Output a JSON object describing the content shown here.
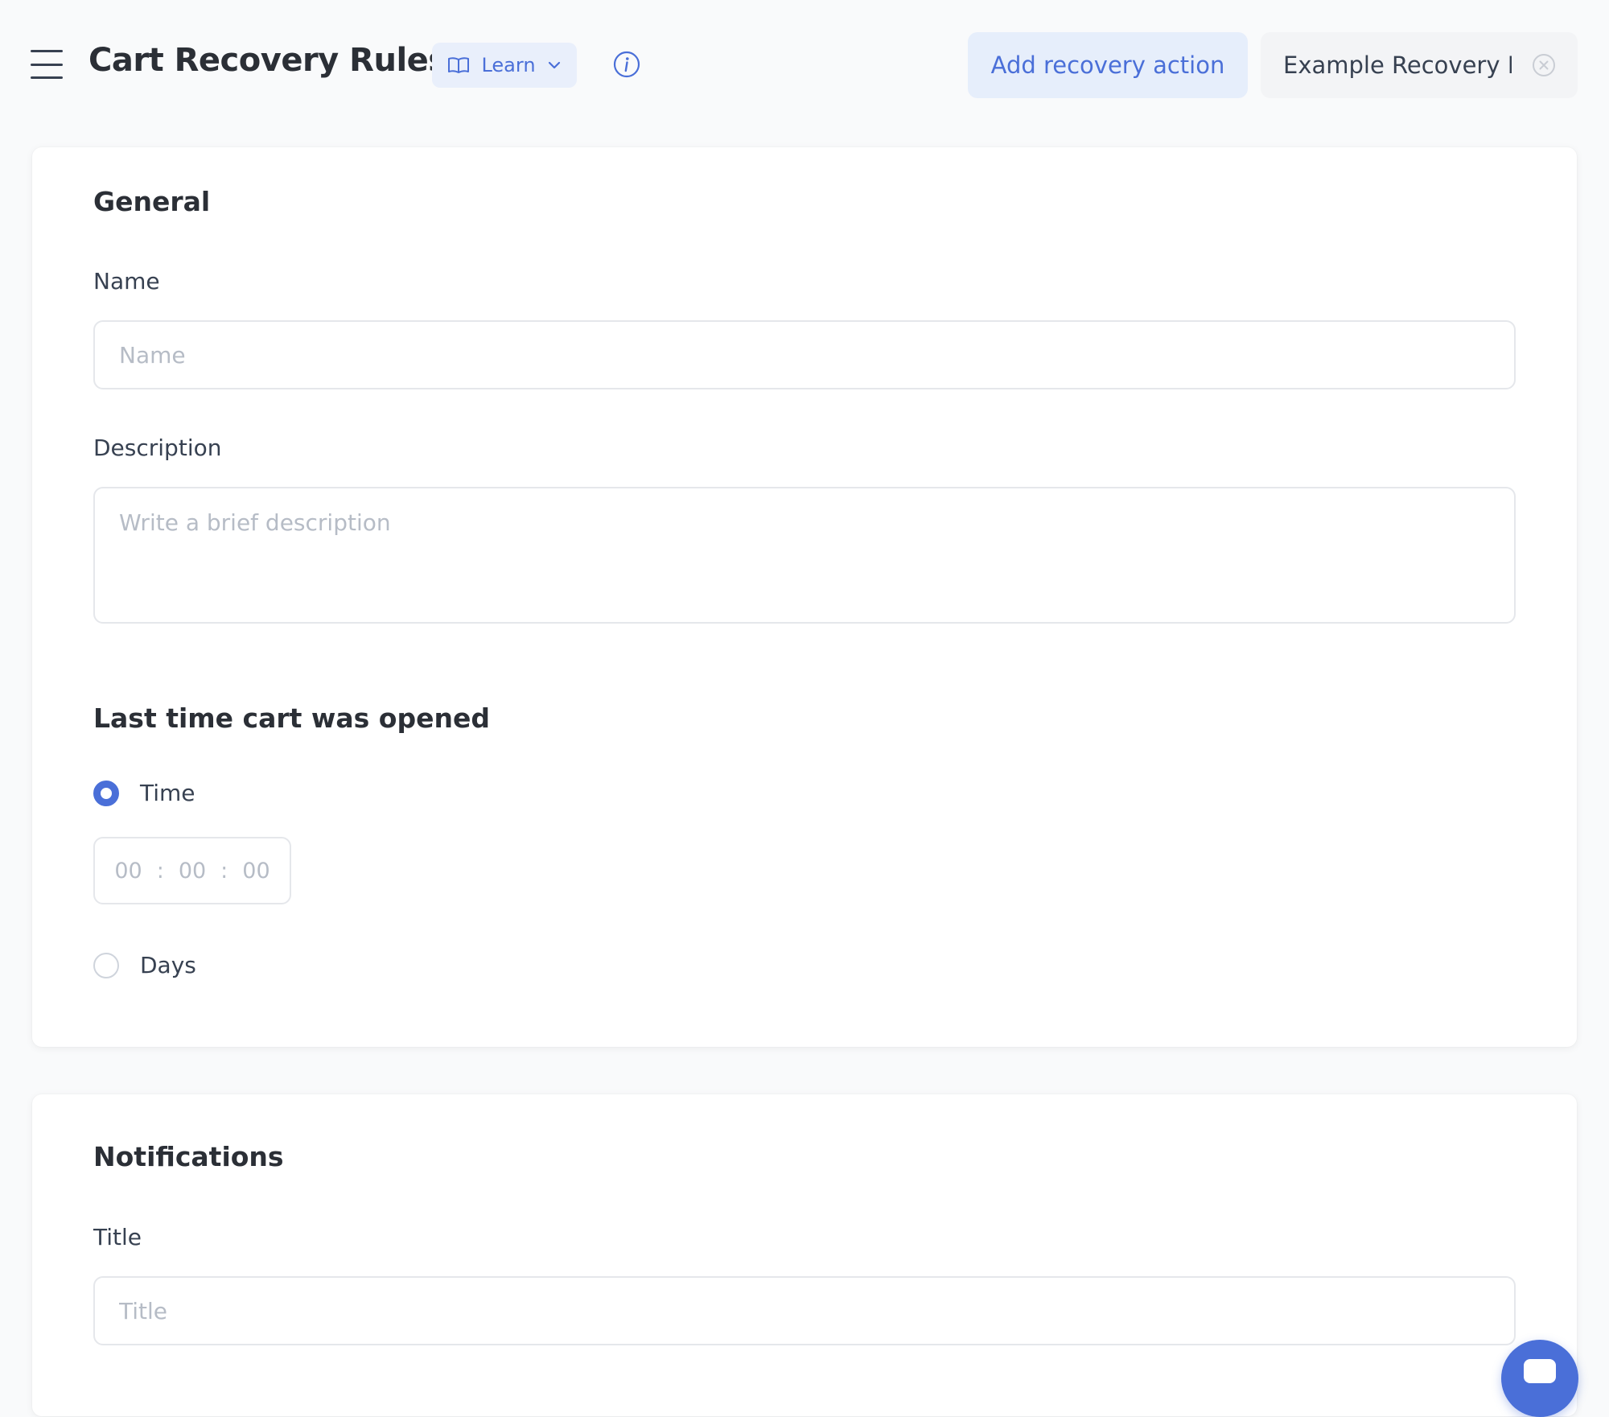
{
  "header": {
    "title": "Cart Recovery Rules",
    "learn_label": "Learn",
    "add_action_label": "Add recovery action",
    "example_label": "Example Recovery D",
    "accent_color": "#4a6fd8"
  },
  "general": {
    "heading": "General",
    "name_label": "Name",
    "name_value": "",
    "name_placeholder": "Name",
    "description_label": "Description",
    "description_value": "",
    "description_placeholder": "Write a brief description"
  },
  "last_opened": {
    "heading": "Last time cart was opened",
    "options": [
      {
        "label": "Time",
        "selected": true
      },
      {
        "label": "Days",
        "selected": false
      }
    ],
    "time": {
      "hours": "00",
      "minutes": "00",
      "seconds": "00",
      "separator": ":"
    }
  },
  "notifications": {
    "heading": "Notifications",
    "title_label": "Title",
    "title_value": "",
    "title_placeholder": "Title"
  },
  "icons": {
    "menu": "hamburger-menu-icon",
    "learn": "book-open-icon",
    "learn_caret": "chevron-down-icon",
    "info": "info-circle-icon",
    "example_close": "close-circle-icon",
    "chat": "chat-bubble-icon"
  }
}
